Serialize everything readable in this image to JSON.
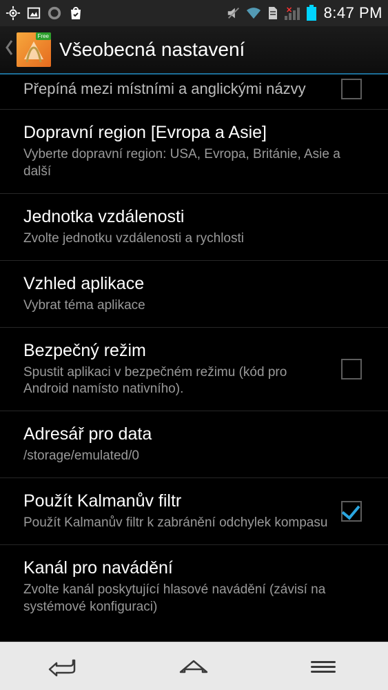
{
  "status": {
    "time": "8:47 PM"
  },
  "header": {
    "title": "Všeobecná nastavení",
    "badge": "Free"
  },
  "rows": {
    "r0": {
      "title": "Přepíná mezi místními a anglickými názvy"
    },
    "r1": {
      "title": "Dopravní region  [Evropa a Asie]",
      "sub": "Vyberte dopravní region: USA, Evropa, Británie, Asie a další"
    },
    "r2": {
      "title": "Jednotka vzdálenosti",
      "sub": "Zvolte jednotku vzdálenosti a rychlosti"
    },
    "r3": {
      "title": "Vzhled aplikace",
      "sub": "Vybrat téma aplikace"
    },
    "r4": {
      "title": "Bezpečný režim",
      "sub": "Spustit aplikaci v bezpečném režimu (kód pro Android namísto nativního)."
    },
    "r5": {
      "title": "Adresář pro data",
      "sub": "/storage/emulated/0"
    },
    "r6": {
      "title": "Použít Kalmanův filtr",
      "sub": "Použít Kalmanův filtr k zabránění odchylek kompasu"
    },
    "r7": {
      "title": "Kanál pro navádění",
      "sub": "Zvolte kanál poskytující hlasové navádění (závisí na systémové konfiguraci)"
    }
  }
}
